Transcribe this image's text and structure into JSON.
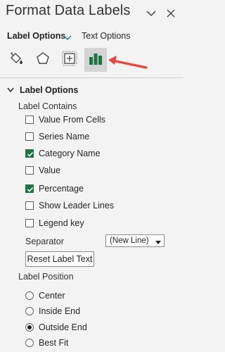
{
  "pane": {
    "title": "Format Data Labels",
    "dropdown_icon": "chevron-down-icon",
    "close_icon": "close-icon"
  },
  "tabs": [
    {
      "label": "Label Options",
      "active": true
    },
    {
      "label": "Text Options",
      "active": false
    }
  ],
  "icon_tabs": [
    {
      "icon": "paint-bucket-icon",
      "selected": false
    },
    {
      "icon": "pentagon-icon",
      "selected": false
    },
    {
      "icon": "size-properties-icon",
      "selected": false
    },
    {
      "icon": "bar-chart-icon",
      "selected": true
    }
  ],
  "section": {
    "title": "Label Options",
    "contains_label": "Label Contains",
    "checkboxes": [
      {
        "label": "Value From Cells",
        "checked": false
      },
      {
        "label": "Series Name",
        "checked": false
      },
      {
        "label": "Category Name",
        "checked": true
      },
      {
        "label": "Value",
        "checked": false
      },
      {
        "label": "Percentage",
        "checked": true
      },
      {
        "label": "Show Leader Lines",
        "checked": false
      },
      {
        "label": "Legend key",
        "checked": false
      }
    ],
    "separator_label": "Separator",
    "separator_value": "(New Line)",
    "reset_button": "Reset Label Text",
    "position_label": "Label Position",
    "positions": [
      {
        "label": "Center",
        "selected": false
      },
      {
        "label": "Inside End",
        "selected": false
      },
      {
        "label": "Outside End",
        "selected": true
      },
      {
        "label": "Best Fit",
        "selected": false
      }
    ]
  },
  "colors": {
    "accent_green": "#217346",
    "arrow_red": "#e8473d",
    "tab_chevron_blue": "#2b79d0"
  }
}
